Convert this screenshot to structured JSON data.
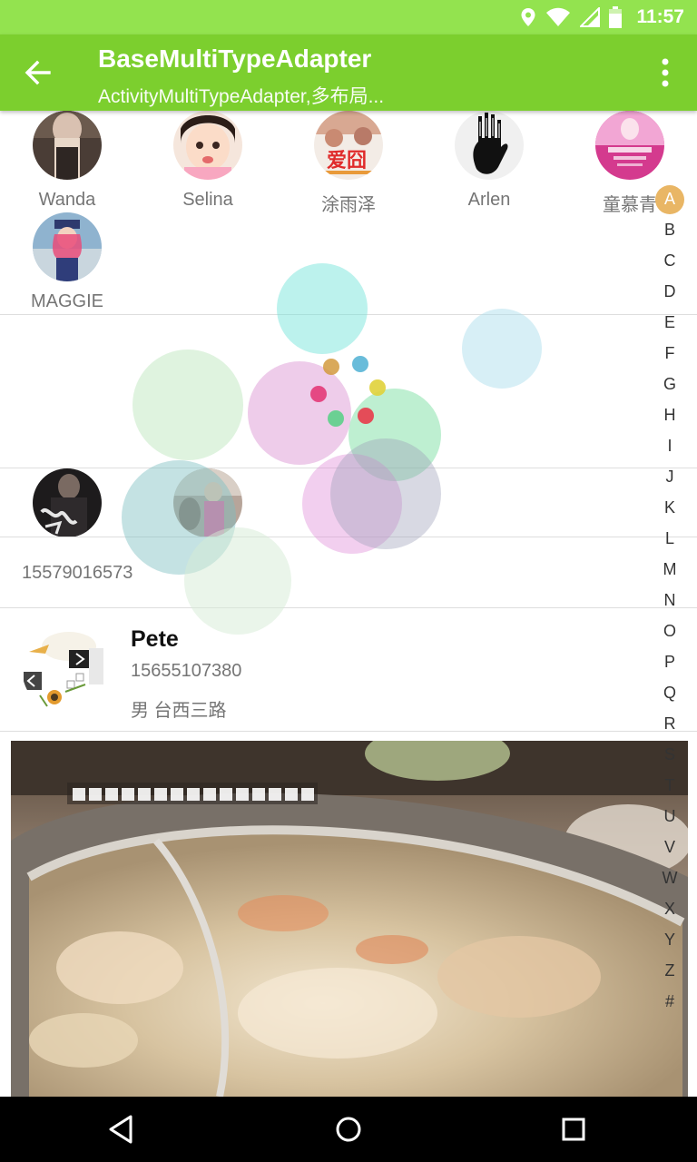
{
  "status_bar": {
    "time": "11:57",
    "icons": [
      "location-icon",
      "wifi-icon",
      "signal-icon",
      "battery-icon"
    ],
    "color": "#93e34f"
  },
  "toolbar": {
    "title": "BaseMultiTypeAdapter",
    "subtitle": "ActivityMultiTypeAdapter,多布局...",
    "back_icon": "arrow-back-icon",
    "overflow_icon": "more-vert-icon",
    "color": "#7ccf2e"
  },
  "grid": {
    "items": [
      {
        "name": "Wanda"
      },
      {
        "name": "Selina"
      },
      {
        "name": "涂雨泽"
      },
      {
        "name": "Arlen"
      },
      {
        "name": "童慕青"
      },
      {
        "name": "MAGGIE"
      }
    ]
  },
  "phone_row": {
    "text": "15579016573"
  },
  "detail": {
    "name": "Pete",
    "phone": "15655107380",
    "info": "男  台西三路"
  },
  "index_bar": {
    "letters": [
      "A",
      "B",
      "C",
      "D",
      "E",
      "F",
      "G",
      "H",
      "I",
      "J",
      "K",
      "L",
      "M",
      "N",
      "O",
      "P",
      "Q",
      "R",
      "S",
      "T",
      "U",
      "V",
      "W",
      "X",
      "Y",
      "Z",
      "#"
    ],
    "selected": "A",
    "selected_color": "#e9b665"
  },
  "nav_bar": {
    "icons": [
      "back-triangle-icon",
      "home-circle-icon",
      "recents-square-icon"
    ]
  }
}
